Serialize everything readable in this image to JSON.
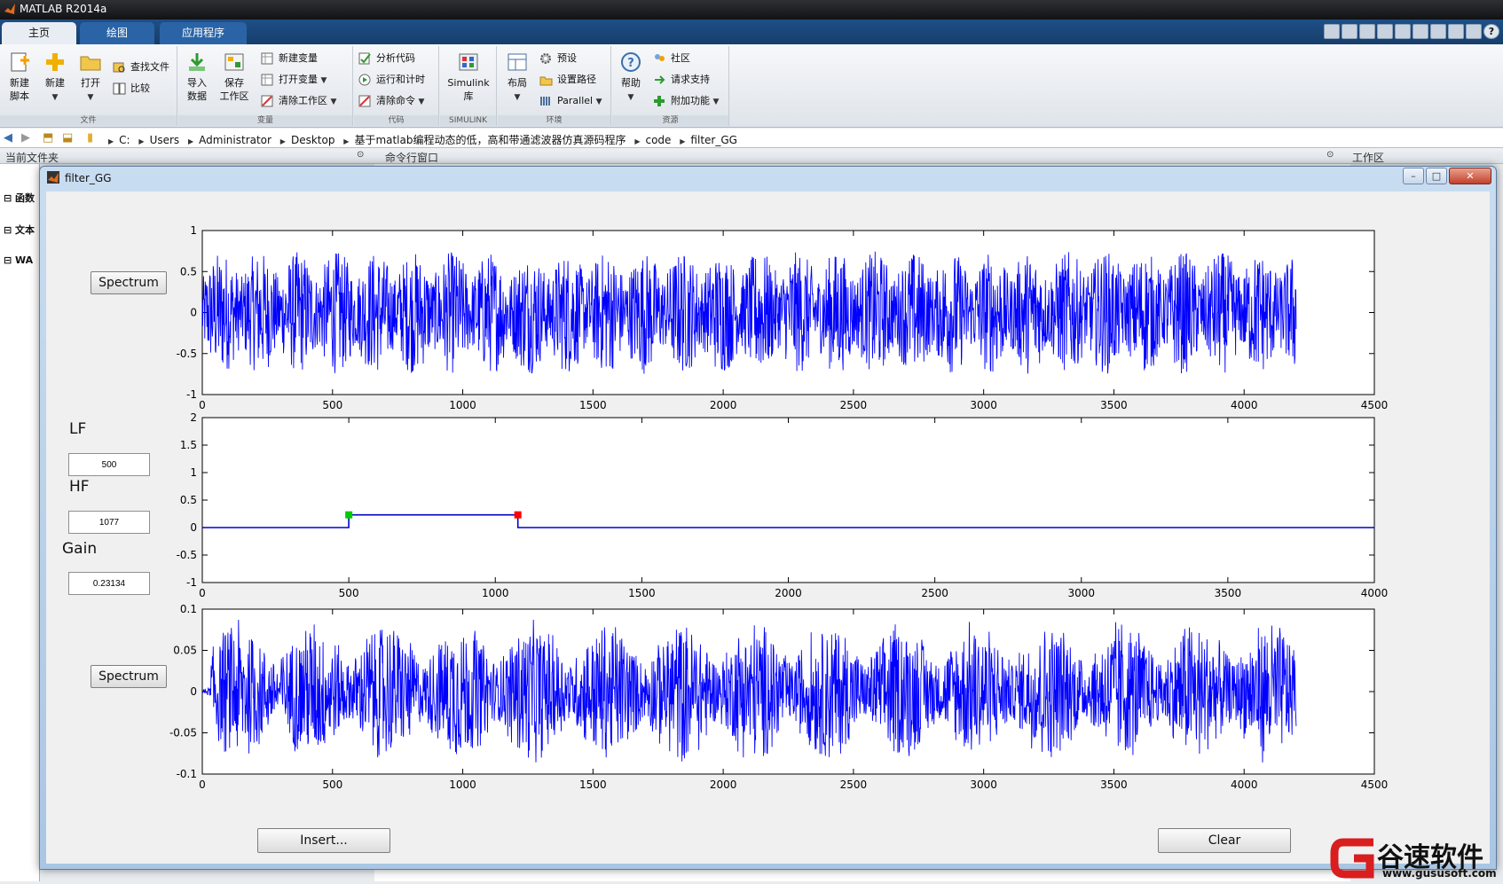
{
  "window": {
    "title": "MATLAB R2014a"
  },
  "tabs": [
    {
      "label": "主页"
    },
    {
      "label": "绘图"
    },
    {
      "label": "应用程序"
    }
  ],
  "ribbon": {
    "file": {
      "label": "文件",
      "new_script": "新建\n脚本",
      "new": "新建",
      "open": "打开",
      "find_files": "查找文件",
      "compare": "比较"
    },
    "variable": {
      "label": "变量",
      "import": "导入\n数据",
      "save_ws": "保存\n工作区",
      "new_var": "新建变量",
      "open_var": "打开变量",
      "clear_ws": "清除工作区"
    },
    "code": {
      "label": "代码",
      "analyze": "分析代码",
      "run_time": "运行和计时",
      "clear_cmds": "清除命令"
    },
    "simulink": {
      "label": "SIMULINK",
      "lib": "Simulink\n库"
    },
    "env": {
      "label": "环境",
      "layout": "布局",
      "prefs": "预设",
      "set_path": "设置路径",
      "parallel": "Parallel"
    },
    "resources": {
      "label": "资源",
      "help": "帮助",
      "community": "社区",
      "support": "请求支持",
      "addons": "附加功能"
    }
  },
  "address": {
    "path": [
      "C:",
      "Users",
      "Administrator",
      "Desktop",
      "基于matlab编程动态的低，高和带通滤波器仿真源码程序",
      "code",
      "filter_GG"
    ]
  },
  "panels": {
    "current_folder": "当前文件夹",
    "command_window": "命令行窗口",
    "workspace": "工作区"
  },
  "left_items": [
    "函数",
    "文本",
    "WA"
  ],
  "figure": {
    "title": "filter_GG",
    "spectrum_top": "Spectrum",
    "spectrum_bottom": "Spectrum",
    "lf_label": "LF",
    "lf_value": "500",
    "hf_label": "HF",
    "hf_value": "1077",
    "gain_label": "Gain",
    "gain_value": "0.23134",
    "insert": "Insert...",
    "clear": "Clear"
  },
  "watermark": {
    "name": "谷速软件",
    "url": "www.gususoft.com"
  },
  "chart_data": [
    {
      "type": "line",
      "title": "",
      "xlabel": "",
      "ylabel": "",
      "xlim": [
        0,
        4500
      ],
      "ylim": [
        -1,
        1
      ],
      "xticks": [
        0,
        500,
        1000,
        1500,
        2000,
        2500,
        3000,
        3500,
        4000,
        4500
      ],
      "yticks": [
        -1,
        -0.5,
        0,
        0.5,
        1
      ],
      "series": [
        {
          "color": "#0000ff",
          "x_range": [
            0,
            4200
          ],
          "y_range": [
            -0.75,
            0.75
          ]
        }
      ]
    },
    {
      "type": "line",
      "title": "",
      "xlabel": "",
      "ylabel": "",
      "xlim": [
        0,
        4000
      ],
      "ylim": [
        -1,
        2
      ],
      "xticks": [
        0,
        500,
        1000,
        1500,
        2000,
        2500,
        3000,
        3500,
        4000
      ],
      "yticks": [
        -1,
        -0.5,
        0,
        0.5,
        1,
        1.5,
        2
      ],
      "series": [
        {
          "color": "#0000cc",
          "x": [
            0,
            500,
            500,
            1077,
            1077,
            4000
          ],
          "y": [
            0,
            0,
            0.23134,
            0.23134,
            0,
            0
          ]
        }
      ],
      "markers": [
        {
          "x": 500,
          "y": 0.23134,
          "color": "#00cc00"
        },
        {
          "x": 1077,
          "y": 0.23134,
          "color": "#ff0000"
        }
      ]
    },
    {
      "type": "line",
      "title": "",
      "xlabel": "",
      "ylabel": "",
      "xlim": [
        0,
        4500
      ],
      "ylim": [
        -0.1,
        0.1
      ],
      "xticks": [
        0,
        500,
        1000,
        1500,
        2000,
        2500,
        3000,
        3500,
        4000,
        4500
      ],
      "yticks": [
        -0.1,
        -0.05,
        0,
        0.05,
        0.1
      ],
      "series": [
        {
          "color": "#0000ff",
          "x_range": [
            0,
            4200
          ],
          "y_range": [
            -0.09,
            0.09
          ]
        }
      ]
    }
  ]
}
